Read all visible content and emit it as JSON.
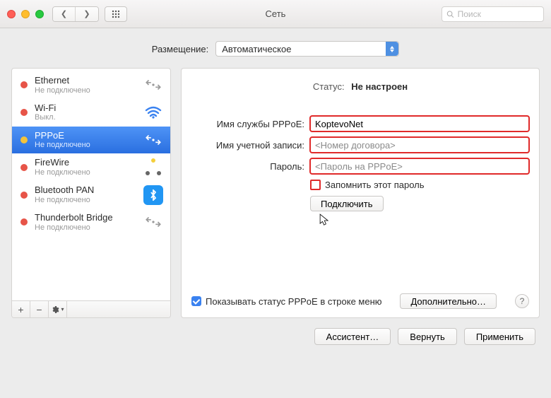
{
  "window": {
    "title": "Сеть"
  },
  "search": {
    "placeholder": "Поиск"
  },
  "location": {
    "label": "Размещение:",
    "value": "Автоматическое"
  },
  "sidebar": {
    "items": [
      {
        "name": "Ethernet",
        "sub": "Не подключено",
        "dot": "red",
        "icon": "linkarr"
      },
      {
        "name": "Wi-Fi",
        "sub": "Выкл.",
        "dot": "red",
        "icon": "wifi"
      },
      {
        "name": "PPPoE",
        "sub": "Не подключено",
        "dot": "yellow",
        "icon": "linkarr",
        "selected": true
      },
      {
        "name": "FireWire",
        "sub": "Не подключено",
        "dot": "red",
        "icon": "fw"
      },
      {
        "name": "Bluetooth PAN",
        "sub": "Не подключено",
        "dot": "red",
        "icon": "bt"
      },
      {
        "name": "Thunderbolt Bridge",
        "sub": "Не подключено",
        "dot": "red",
        "icon": "linkarr"
      }
    ]
  },
  "status": {
    "label": "Статус:",
    "value": "Не настроен"
  },
  "form": {
    "service_label": "Имя службы PPPoE:",
    "service_value": "KoptevoNet",
    "account_label": "Имя учетной записи:",
    "account_placeholder": "<Номер договора>",
    "password_label": "Пароль:",
    "password_placeholder": "<Пароль на PPPoE>",
    "remember_label": "Запомнить этот пароль",
    "connect_label": "Подключить"
  },
  "footer": {
    "show_status": "Показывать статус PPPoE в строке меню",
    "advanced": "Дополнительно…"
  },
  "bottom": {
    "assistant": "Ассистент…",
    "revert": "Вернуть",
    "apply": "Применить"
  }
}
